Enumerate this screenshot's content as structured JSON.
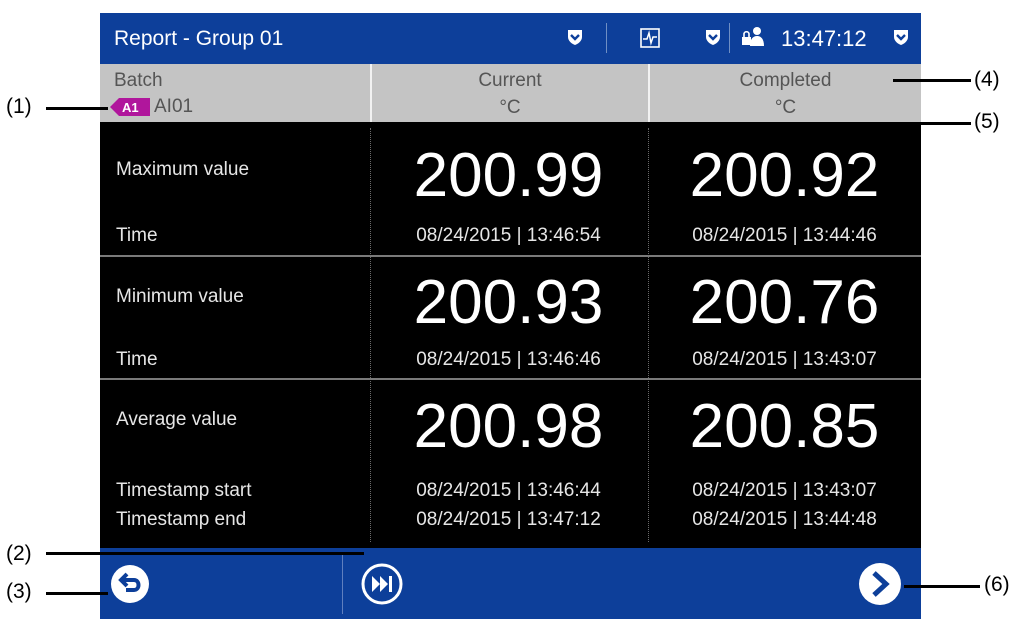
{
  "titlebar": {
    "title": "Report - Group 01",
    "clock": "13:47:12"
  },
  "header": {
    "batch_label": "Batch",
    "alarm_tag": "A1",
    "channel": "AI01",
    "columns": [
      {
        "title": "Current",
        "unit": "°C"
      },
      {
        "title": "Completed",
        "unit": "°C"
      }
    ]
  },
  "rows": [
    {
      "label": "Maximum value",
      "time_label": "Time",
      "current": "200.99",
      "completed": "200.92",
      "current_time": "08/24/2015 | 13:46:54",
      "completed_time": "08/24/2015 | 13:44:46"
    },
    {
      "label": "Minimum value",
      "time_label": "Time",
      "current": "200.93",
      "completed": "200.76",
      "current_time": "08/24/2015 | 13:46:46",
      "completed_time": "08/24/2015 | 13:43:07"
    },
    {
      "label": "Average value",
      "start_label": "Timestamp start",
      "end_label": "Timestamp end",
      "current": "200.98",
      "completed": "200.85",
      "current_start": "08/24/2015 | 13:46:44",
      "completed_start": "08/24/2015 | 13:43:07",
      "current_end": "08/24/2015 | 13:47:12",
      "completed_end": "08/24/2015 | 13:44:48"
    }
  ],
  "footer": {
    "buttons": [
      "back-icon",
      "fast-forward-icon",
      "next-icon"
    ]
  },
  "callouts": {
    "c1": "(1)",
    "c2": "(2)",
    "c3": "(3)",
    "c4": "(4)",
    "c5": "(5)",
    "c6": "(6)"
  },
  "colors": {
    "titlebar": "#0d3f9a",
    "header": "#c4c4c4",
    "tag": "#b0169c",
    "background": "#000000"
  }
}
